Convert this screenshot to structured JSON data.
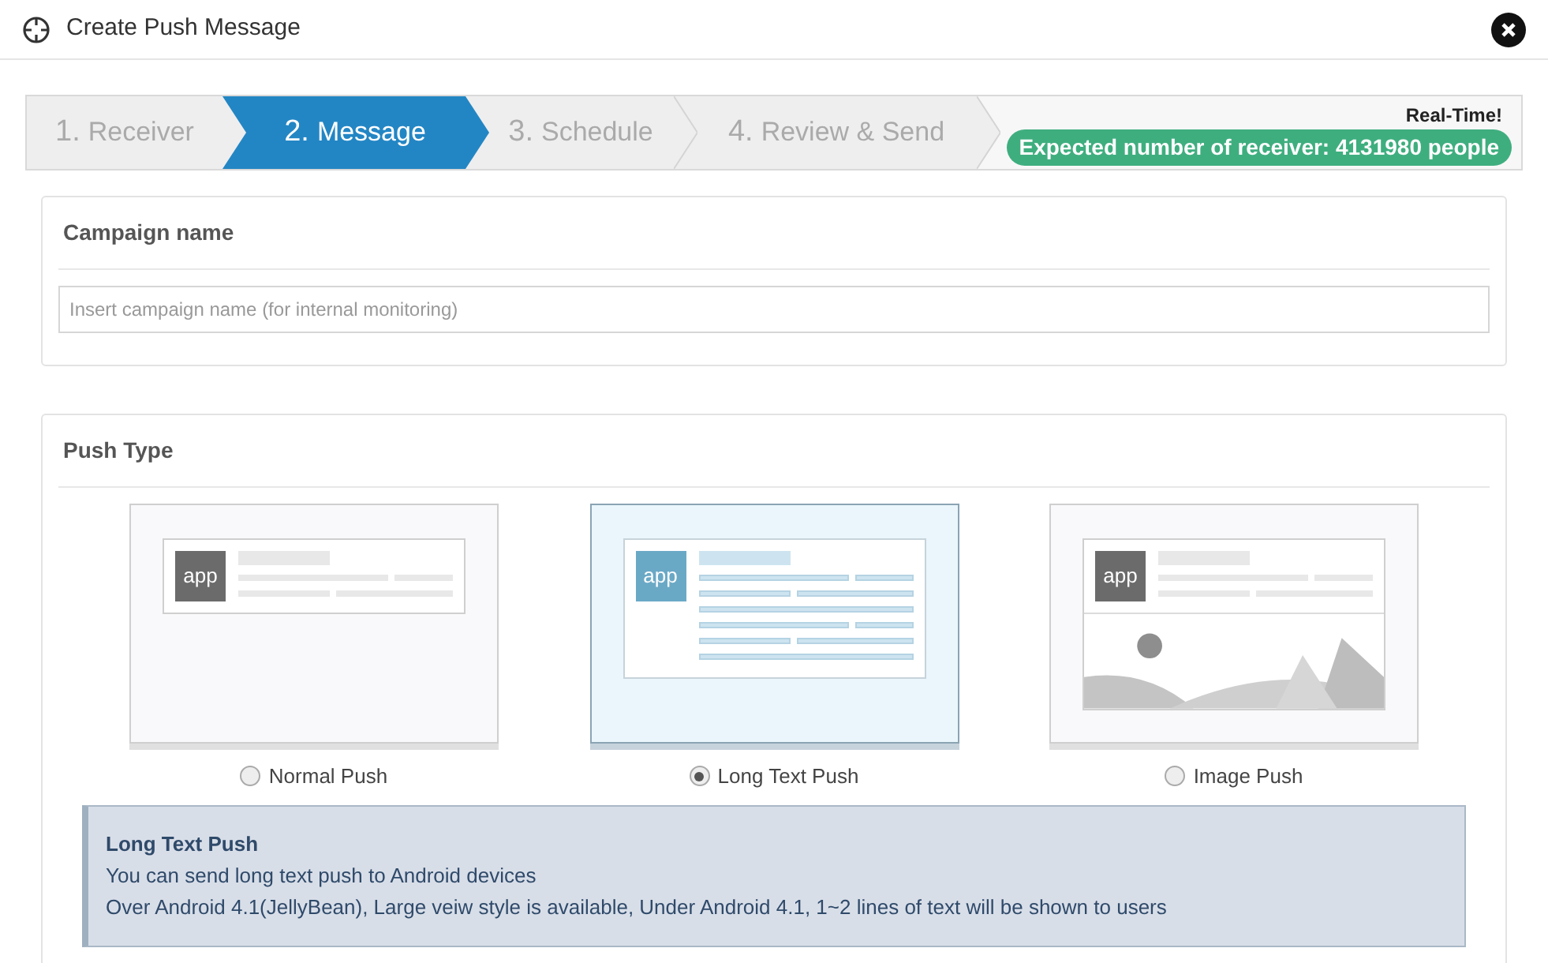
{
  "window": {
    "title": "Create Push Message"
  },
  "steps": [
    {
      "number": "1.",
      "label": "Receiver",
      "selected": false
    },
    {
      "number": "2.",
      "label": "Message",
      "selected": true
    },
    {
      "number": "3.",
      "label": "Schedule",
      "selected": false
    },
    {
      "number": "4.",
      "label": "Review & Send",
      "selected": false
    }
  ],
  "realtime": {
    "label": "Real-Time!",
    "badge": "Expected number of receiver: 4131980 people"
  },
  "campaign": {
    "title": "Campaign name",
    "placeholder": "Insert campaign name (for internal monitoring)"
  },
  "push_type": {
    "title": "Push Type",
    "options": [
      {
        "kind": "normal",
        "label": "Normal Push",
        "icon_text": "app",
        "selected": false
      },
      {
        "kind": "long",
        "label": "Long Text Push",
        "icon_text": "app",
        "selected": true
      },
      {
        "kind": "image",
        "label": "Image Push",
        "icon_text": "app",
        "selected": false
      }
    ],
    "info": {
      "title": "Long Text Push",
      "lines": [
        "You can send long text push to Android devices",
        "Over Android 4.1(JellyBean), Large veiw style is available, Under Android 4.1, 1~2 lines of text will be shown to users"
      ]
    }
  }
}
